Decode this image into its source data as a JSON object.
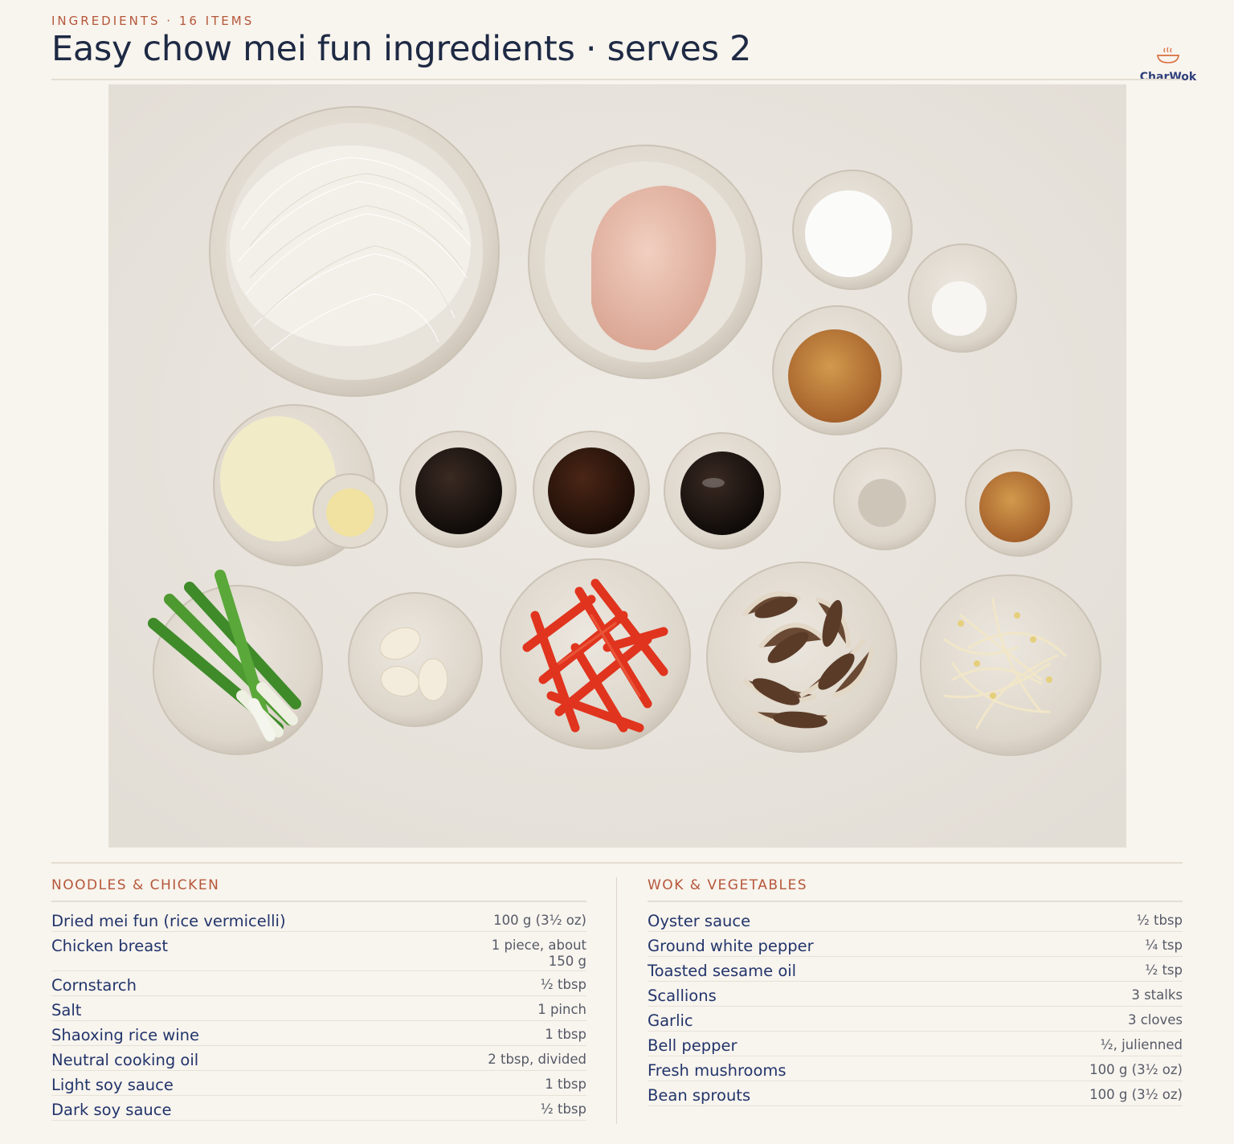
{
  "header": {
    "kicker": "INGREDIENTS · 16 ITEMS",
    "title": "Easy chow mei fun ingredients · serves 2"
  },
  "logo": {
    "text": "CharWok",
    "icon": "steaming-bowl-icon"
  },
  "photo": {
    "icon": "ingredients-flat-lay-photo"
  },
  "sections": [
    {
      "heading": "NOODLES & CHICKEN",
      "items": [
        {
          "name": "Dried mei fun (rice vermicelli)",
          "qty": "100 g (3½ oz)"
        },
        {
          "name": "Chicken breast",
          "qty": "1 piece, about 150 g"
        },
        {
          "name": "Cornstarch",
          "qty": "½ tbsp"
        },
        {
          "name": "Salt",
          "qty": "1 pinch"
        },
        {
          "name": "Shaoxing rice wine",
          "qty": "1 tbsp"
        },
        {
          "name": "Neutral cooking oil",
          "qty": "2 tbsp, divided"
        },
        {
          "name": "Light soy sauce",
          "qty": "1 tbsp"
        },
        {
          "name": "Dark soy sauce",
          "qty": "½ tbsp"
        }
      ]
    },
    {
      "heading": "WOK & VEGETABLES",
      "items": [
        {
          "name": "Oyster sauce",
          "qty": "½ tbsp"
        },
        {
          "name": "Ground white pepper",
          "qty": "¼ tsp"
        },
        {
          "name": "Toasted sesame oil",
          "qty": "½ tsp"
        },
        {
          "name": "Scallions",
          "qty": "3 stalks"
        },
        {
          "name": "Garlic",
          "qty": "3 cloves"
        },
        {
          "name": "Bell pepper",
          "qty": "½, julienned"
        },
        {
          "name": "Fresh mushrooms",
          "qty": "100 g (3½ oz)"
        },
        {
          "name": "Bean sprouts",
          "qty": "100 g (3½ oz)"
        }
      ]
    }
  ],
  "colors": {
    "background": "#f8f4ee",
    "accent": "#b5573a",
    "ingredient_text": "#22356b",
    "title_text": "#1e2a44"
  }
}
